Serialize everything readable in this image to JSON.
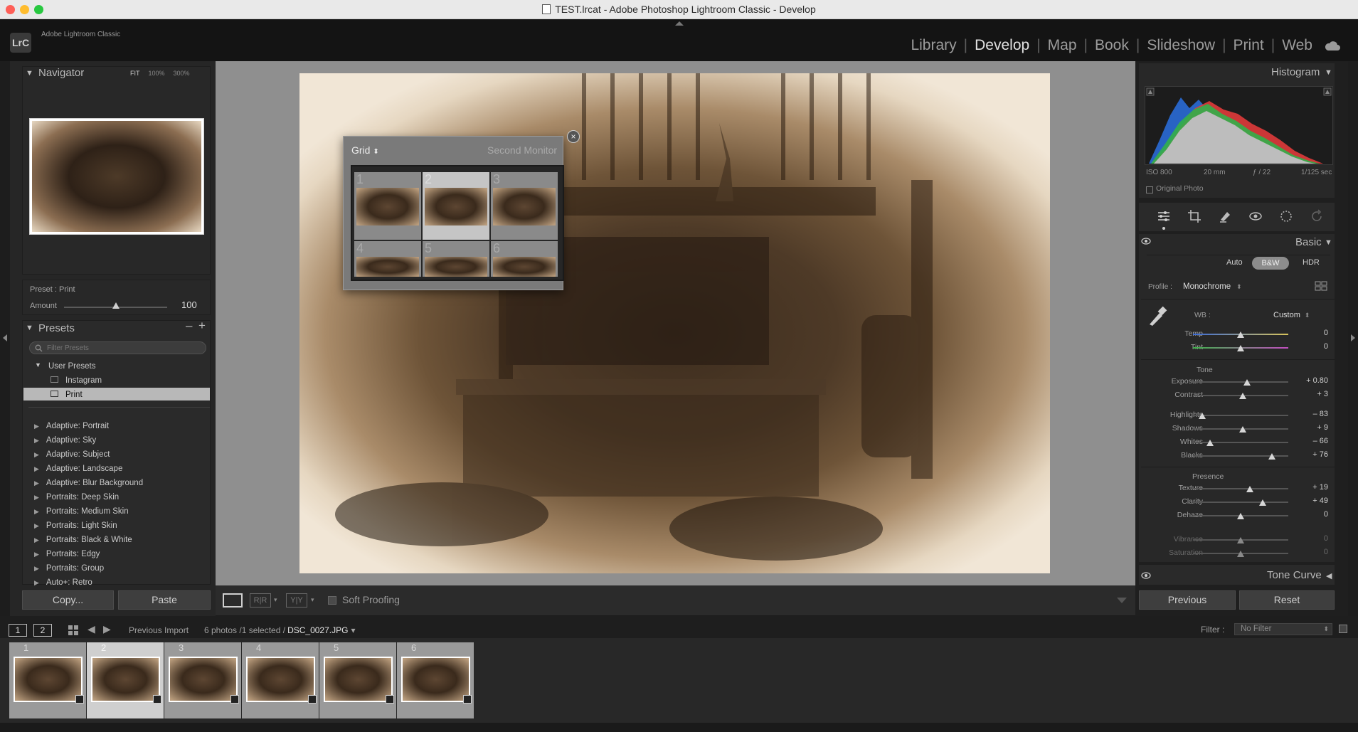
{
  "window": {
    "title": "TEST.lrcat - Adobe Photoshop Lightroom Classic - Develop"
  },
  "identity": {
    "logo": "LrC",
    "app_name": "Adobe Lightroom Classic"
  },
  "modules": [
    "Library",
    "Develop",
    "Map",
    "Book",
    "Slideshow",
    "Print",
    "Web"
  ],
  "left_panel": {
    "navigator": {
      "title": "Navigator",
      "zoom": [
        "FIT",
        "100%",
        "300%"
      ]
    },
    "preset_info": {
      "label": "Preset : Print",
      "amount_label": "Amount",
      "amount_value": "100"
    },
    "presets": {
      "title": "Presets",
      "filter_placeholder": "Filter Presets",
      "user_presets_label": "User Presets",
      "user_presets": [
        "Instagram",
        "Print"
      ],
      "groups": [
        "Adaptive: Portrait",
        "Adaptive: Sky",
        "Adaptive: Subject",
        "Adaptive: Landscape",
        "Adaptive: Blur Background",
        "Portraits: Deep Skin",
        "Portraits: Medium Skin",
        "Portraits: Light Skin",
        "Portraits: Black & White",
        "Portraits: Edgy",
        "Portraits: Group",
        "Auto+: Retro"
      ]
    },
    "copy_label": "Copy...",
    "paste_label": "Paste"
  },
  "second_monitor": {
    "view": "Grid",
    "title": "Second Monitor",
    "thumb_numbers": [
      "1",
      "2",
      "3",
      "4",
      "5",
      "6"
    ]
  },
  "toolbar": {
    "soft_proofing": "Soft Proofing"
  },
  "right_panel": {
    "histogram": {
      "title": "Histogram",
      "iso": "ISO 800",
      "focal": "20 mm",
      "aperture": "ƒ / 22",
      "shutter": "1/125 sec",
      "original_photo": "Original Photo"
    },
    "basic": {
      "title": "Basic",
      "treatments": [
        "Auto",
        "B&W",
        "HDR"
      ],
      "profile_label": "Profile :",
      "profile_value": "Monochrome",
      "wb_label": "WB :",
      "wb_value": "Custom",
      "wb_sliders": [
        {
          "label": "Temp",
          "value": "0"
        },
        {
          "label": "Tint",
          "value": "0"
        }
      ],
      "tone_title": "Tone",
      "tone_sliders": [
        {
          "label": "Exposure",
          "value": "+ 0.80"
        },
        {
          "label": "Contrast",
          "value": "+ 3"
        }
      ],
      "tone_sliders2": [
        {
          "label": "Highlights",
          "value": "– 83"
        },
        {
          "label": "Shadows",
          "value": "+ 9"
        },
        {
          "label": "Whites",
          "value": "– 66"
        },
        {
          "label": "Blacks",
          "value": "+ 76"
        }
      ],
      "presence_title": "Presence",
      "presence_sliders": [
        {
          "label": "Texture",
          "value": "+ 19"
        },
        {
          "label": "Clarity",
          "value": "+ 49"
        },
        {
          "label": "Dehaze",
          "value": "0"
        }
      ],
      "presence_sliders2": [
        {
          "label": "Vibrance",
          "value": "0"
        },
        {
          "label": "Saturation",
          "value": "0"
        }
      ]
    },
    "tone_curve_title": "Tone Curve",
    "previous_label": "Previous",
    "reset_label": "Reset"
  },
  "filmstrip_bar": {
    "monitor1": "1",
    "monitor2": "2",
    "source": "Previous Import",
    "count": "6 photos /1 selected /",
    "filename": "DSC_0027.JPG",
    "filter_label": "Filter :",
    "filter_value": "No Filter"
  },
  "filmstrip": [
    "1",
    "2",
    "3",
    "4",
    "5",
    "6"
  ]
}
